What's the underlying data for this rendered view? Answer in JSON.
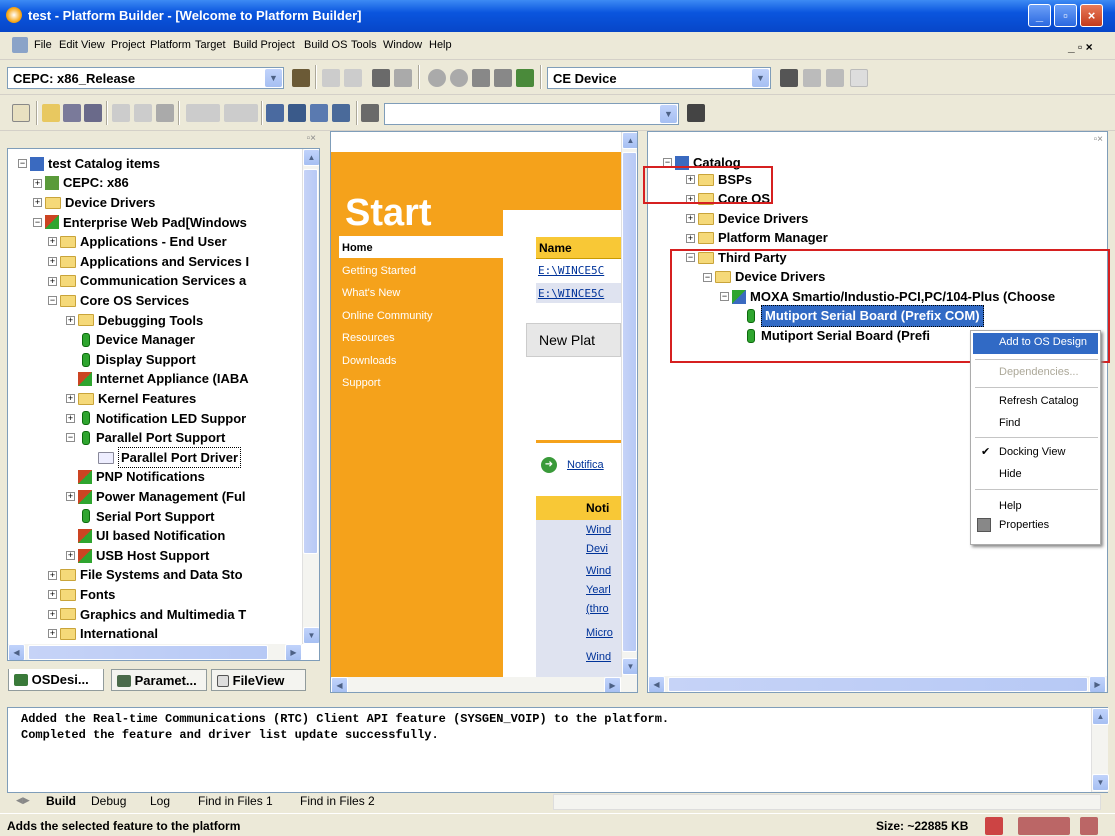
{
  "window": {
    "title": "test - Platform Builder - [Welcome to Platform Builder]"
  },
  "menu": {
    "items": [
      "File",
      "Edit",
      "View",
      "Project",
      "Platform",
      "Target",
      "Build Project",
      "Build OS",
      "Tools",
      "Window",
      "Help"
    ],
    "mdi_controls": "_ ▫ ×"
  },
  "toolbar": {
    "config_combo": "CEPC: x86_Release",
    "device_combo": "CE Device",
    "search_combo": ""
  },
  "left_tree": {
    "items": [
      "test Catalog items",
      "CEPC: x86",
      "Device Drivers",
      "Enterprise Web Pad[Windows",
      "Applications - End User",
      "Applications and Services I",
      "Communication Services a",
      "Core OS Services",
      "Debugging Tools",
      "Device Manager",
      "Display Support",
      "Internet Appliance (IABA",
      "Kernel Features",
      "Notification LED Suppor",
      "Parallel Port Support",
      "Parallel Port Driver",
      "PNP Notifications",
      "Power Management (Ful",
      "Serial Port Support",
      "UI based Notification",
      "USB Host Support",
      "File Systems and Data Sto",
      "Fonts",
      "Graphics and Multimedia T",
      "International"
    ],
    "tabs": [
      "OSDesi...",
      "Paramet...",
      "FileView"
    ]
  },
  "start_page": {
    "title": "Start",
    "nav": [
      "Home",
      "Getting Started",
      "What's New",
      "Online Community",
      "Resources",
      "Downloads",
      "Support"
    ],
    "name_header": "Name",
    "files": [
      "E:\\WINCE5C",
      "E:\\WINCE5C"
    ],
    "new_button": "New Plat",
    "notification_link": "Notifica",
    "notif_header": "Noti",
    "notif_items": [
      "Wind",
      "Devi",
      "Wind",
      "Yearl",
      "(thro",
      "Micro",
      "Wind"
    ]
  },
  "catalog_tree": {
    "root": "Catalog",
    "items": [
      "BSPs",
      "Core OS",
      "Device Drivers",
      "Platform Manager",
      "Third Party",
      "Device Drivers",
      "MOXA Smartio/Industio-PCI,PC/104-Plus (Choose",
      "Mutiport Serial Board (Prefix COM)",
      "Mutiport Serial Board (Prefi"
    ]
  },
  "context_menu": {
    "items": [
      "Add to OS Design",
      "Dependencies...",
      "Refresh Catalog",
      "Find",
      "Docking View",
      "Hide",
      "Help",
      "Properties"
    ],
    "docking_check": "✔"
  },
  "output": {
    "lines": [
      "Added the Real-time Communications (RTC) Client API feature (SYSGEN_VOIP) to the platform.",
      "Completed the feature and driver list update successfully."
    ],
    "tabs": [
      "Build",
      "Debug",
      "Log",
      "Find in Files 1",
      "Find in Files 2"
    ]
  },
  "status": {
    "message": "Adds the selected feature to the platform",
    "size": "Size: ~22885 KB"
  },
  "colors": {
    "titlebar": "#0a55de",
    "start_orange": "#f5a21b",
    "highlight": "#316ac5",
    "annotation_red": "#d62020"
  }
}
